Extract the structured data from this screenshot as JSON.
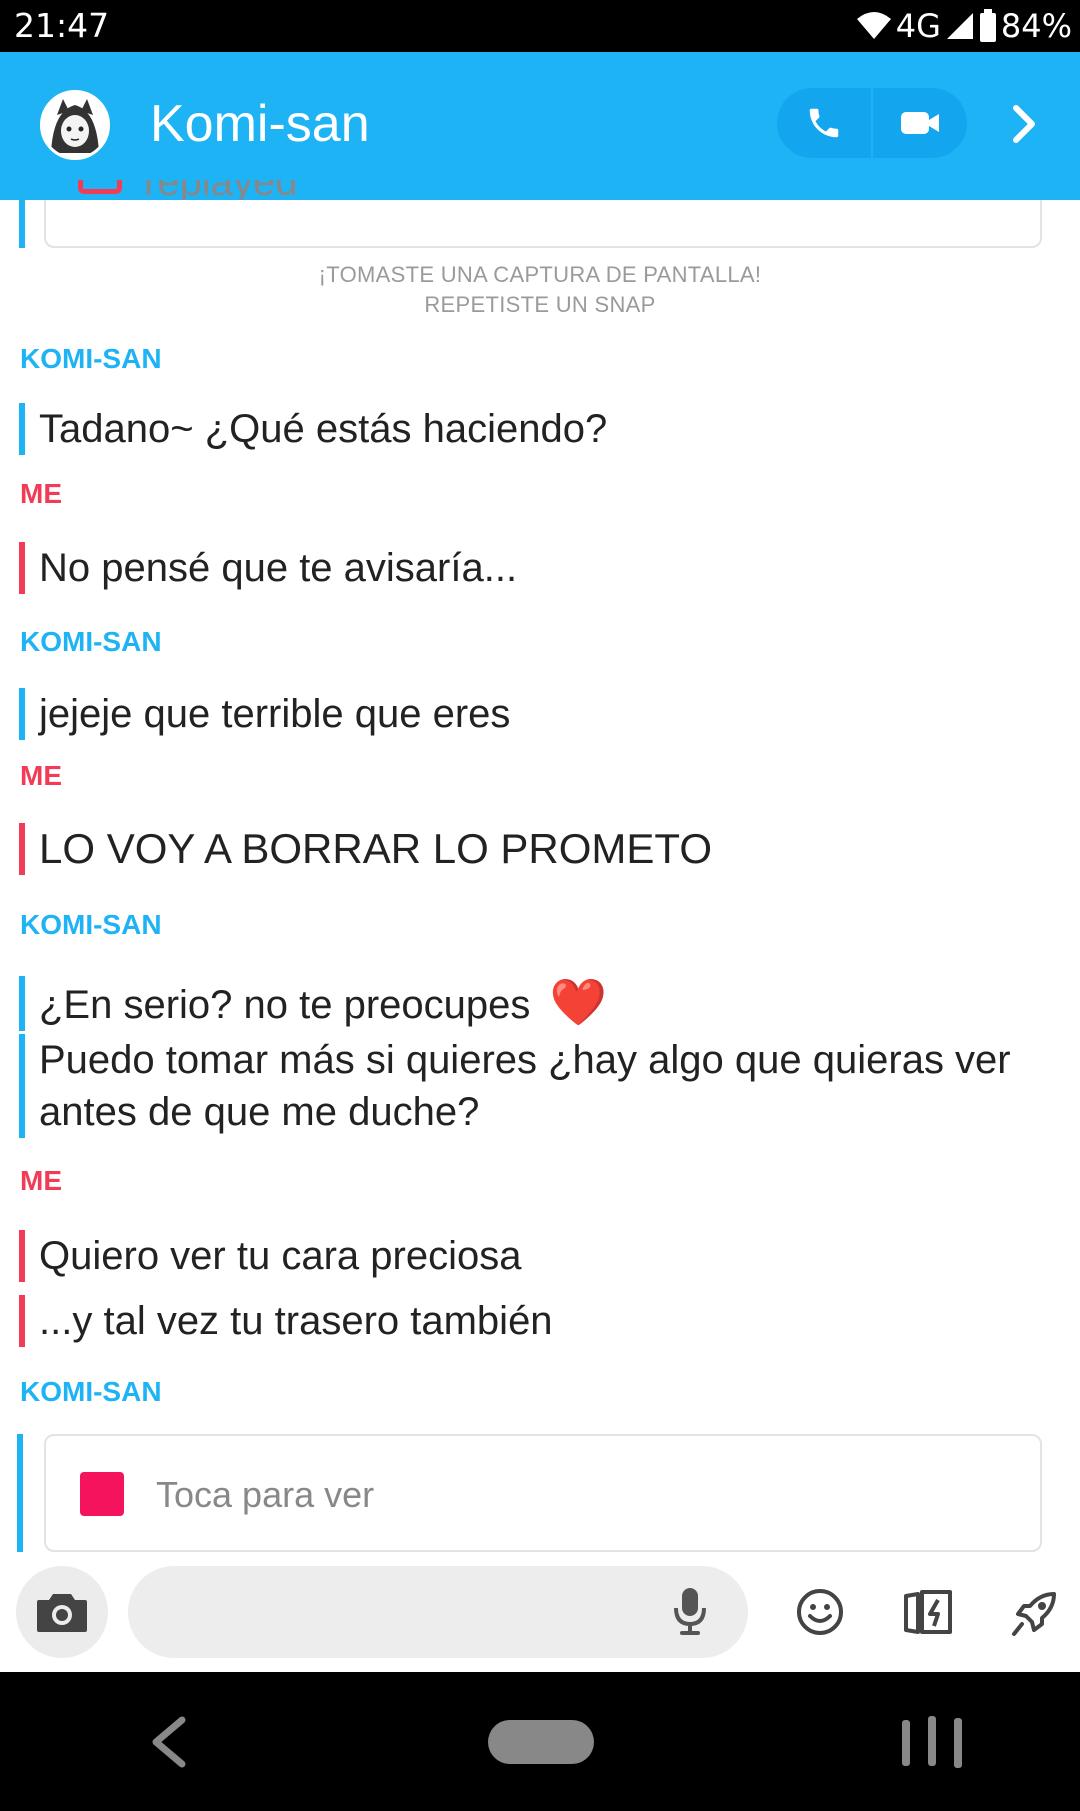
{
  "status_bar": {
    "time": "21:47",
    "network": "4G",
    "battery": "84%",
    "wifi_icon": "wifi-icon",
    "signal_icon": "signal-icon",
    "battery_icon": "battery-icon"
  },
  "header": {
    "contact_name": "Komi-san",
    "call_icon": "phone-icon",
    "video_icon": "video-icon",
    "more_icon": "chevron-right-icon",
    "accent_color": "#1EB3F5"
  },
  "top_card": {
    "label": "replayed"
  },
  "system_notes": {
    "line1": "¡TOMASTE UNA CAPTURA DE PANTALLA!",
    "line2": "REPETISTE UN SNAP"
  },
  "conversation": {
    "them_color": "#1EB3F5",
    "me_color": "#F23C57",
    "blocks": [
      {
        "sender": "KOMI-SAN",
        "messages": [
          "Tadano~ ¿Qué estás haciendo?"
        ]
      },
      {
        "sender": "ME",
        "messages": [
          "No pensé que te avisaría..."
        ]
      },
      {
        "sender": "KOMI-SAN",
        "messages": [
          "jejeje que terrible que eres"
        ]
      },
      {
        "sender": "ME",
        "messages": [
          "LO VOY A BORRAR LO PROMETO"
        ]
      },
      {
        "sender": "KOMI-SAN",
        "messages": [
          "¿En serio? no te preocupes",
          "Puedo tomar más si quieres ¿hay algo que quieras ver antes de que me duche?"
        ],
        "emoji": "❤️"
      },
      {
        "sender": "ME",
        "messages": [
          "Quiero ver tu cara preciosa",
          "...y tal vez tu trasero también"
        ]
      },
      {
        "sender": "KOMI-SAN",
        "snap_label": "Toca para ver"
      }
    ]
  },
  "input_bar": {
    "camera_icon": "camera-icon",
    "mic_icon": "microphone-icon",
    "emoji_icon": "smiley-icon",
    "stickers_icon": "sticker-icon",
    "games_icon": "rocket-icon"
  },
  "nav_bar": {
    "back_icon": "back-icon",
    "home_icon": "home-icon",
    "recents_icon": "recents-icon"
  }
}
